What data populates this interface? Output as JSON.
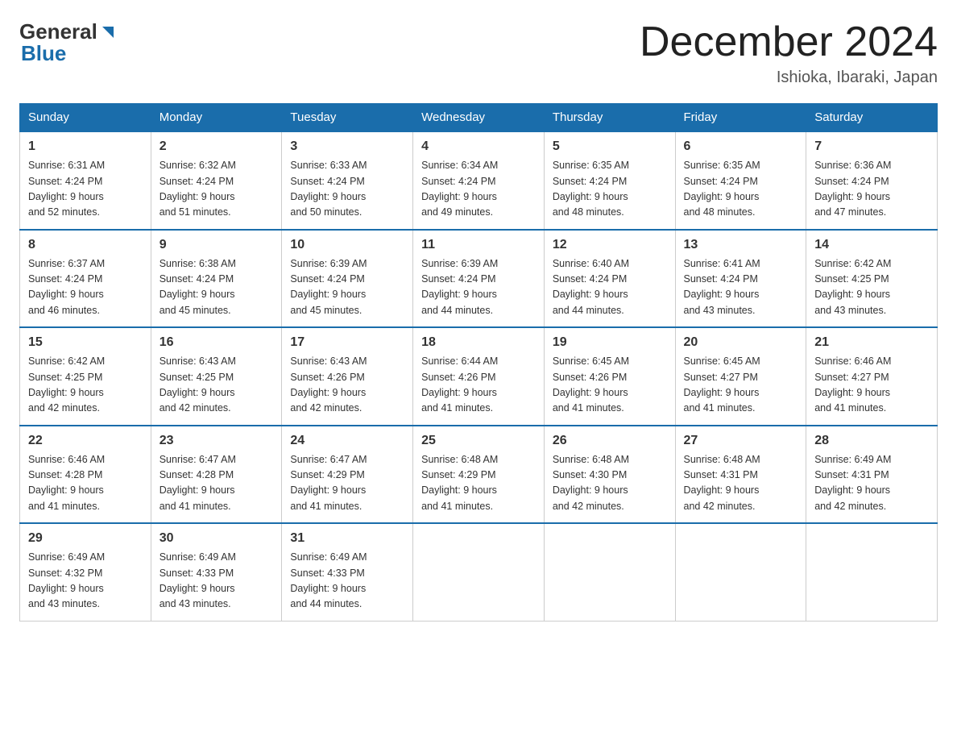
{
  "header": {
    "logo_general": "General",
    "logo_blue": "Blue",
    "title": "December 2024",
    "location": "Ishioka, Ibaraki, Japan"
  },
  "weekdays": [
    "Sunday",
    "Monday",
    "Tuesday",
    "Wednesday",
    "Thursday",
    "Friday",
    "Saturday"
  ],
  "weeks": [
    [
      {
        "day": "1",
        "sunrise": "6:31 AM",
        "sunset": "4:24 PM",
        "daylight": "9 hours and 52 minutes."
      },
      {
        "day": "2",
        "sunrise": "6:32 AM",
        "sunset": "4:24 PM",
        "daylight": "9 hours and 51 minutes."
      },
      {
        "day": "3",
        "sunrise": "6:33 AM",
        "sunset": "4:24 PM",
        "daylight": "9 hours and 50 minutes."
      },
      {
        "day": "4",
        "sunrise": "6:34 AM",
        "sunset": "4:24 PM",
        "daylight": "9 hours and 49 minutes."
      },
      {
        "day": "5",
        "sunrise": "6:35 AM",
        "sunset": "4:24 PM",
        "daylight": "9 hours and 48 minutes."
      },
      {
        "day": "6",
        "sunrise": "6:35 AM",
        "sunset": "4:24 PM",
        "daylight": "9 hours and 48 minutes."
      },
      {
        "day": "7",
        "sunrise": "6:36 AM",
        "sunset": "4:24 PM",
        "daylight": "9 hours and 47 minutes."
      }
    ],
    [
      {
        "day": "8",
        "sunrise": "6:37 AM",
        "sunset": "4:24 PM",
        "daylight": "9 hours and 46 minutes."
      },
      {
        "day": "9",
        "sunrise": "6:38 AM",
        "sunset": "4:24 PM",
        "daylight": "9 hours and 45 minutes."
      },
      {
        "day": "10",
        "sunrise": "6:39 AM",
        "sunset": "4:24 PM",
        "daylight": "9 hours and 45 minutes."
      },
      {
        "day": "11",
        "sunrise": "6:39 AM",
        "sunset": "4:24 PM",
        "daylight": "9 hours and 44 minutes."
      },
      {
        "day": "12",
        "sunrise": "6:40 AM",
        "sunset": "4:24 PM",
        "daylight": "9 hours and 44 minutes."
      },
      {
        "day": "13",
        "sunrise": "6:41 AM",
        "sunset": "4:24 PM",
        "daylight": "9 hours and 43 minutes."
      },
      {
        "day": "14",
        "sunrise": "6:42 AM",
        "sunset": "4:25 PM",
        "daylight": "9 hours and 43 minutes."
      }
    ],
    [
      {
        "day": "15",
        "sunrise": "6:42 AM",
        "sunset": "4:25 PM",
        "daylight": "9 hours and 42 minutes."
      },
      {
        "day": "16",
        "sunrise": "6:43 AM",
        "sunset": "4:25 PM",
        "daylight": "9 hours and 42 minutes."
      },
      {
        "day": "17",
        "sunrise": "6:43 AM",
        "sunset": "4:26 PM",
        "daylight": "9 hours and 42 minutes."
      },
      {
        "day": "18",
        "sunrise": "6:44 AM",
        "sunset": "4:26 PM",
        "daylight": "9 hours and 41 minutes."
      },
      {
        "day": "19",
        "sunrise": "6:45 AM",
        "sunset": "4:26 PM",
        "daylight": "9 hours and 41 minutes."
      },
      {
        "day": "20",
        "sunrise": "6:45 AM",
        "sunset": "4:27 PM",
        "daylight": "9 hours and 41 minutes."
      },
      {
        "day": "21",
        "sunrise": "6:46 AM",
        "sunset": "4:27 PM",
        "daylight": "9 hours and 41 minutes."
      }
    ],
    [
      {
        "day": "22",
        "sunrise": "6:46 AM",
        "sunset": "4:28 PM",
        "daylight": "9 hours and 41 minutes."
      },
      {
        "day": "23",
        "sunrise": "6:47 AM",
        "sunset": "4:28 PM",
        "daylight": "9 hours and 41 minutes."
      },
      {
        "day": "24",
        "sunrise": "6:47 AM",
        "sunset": "4:29 PM",
        "daylight": "9 hours and 41 minutes."
      },
      {
        "day": "25",
        "sunrise": "6:48 AM",
        "sunset": "4:29 PM",
        "daylight": "9 hours and 41 minutes."
      },
      {
        "day": "26",
        "sunrise": "6:48 AM",
        "sunset": "4:30 PM",
        "daylight": "9 hours and 42 minutes."
      },
      {
        "day": "27",
        "sunrise": "6:48 AM",
        "sunset": "4:31 PM",
        "daylight": "9 hours and 42 minutes."
      },
      {
        "day": "28",
        "sunrise": "6:49 AM",
        "sunset": "4:31 PM",
        "daylight": "9 hours and 42 minutes."
      }
    ],
    [
      {
        "day": "29",
        "sunrise": "6:49 AM",
        "sunset": "4:32 PM",
        "daylight": "9 hours and 43 minutes."
      },
      {
        "day": "30",
        "sunrise": "6:49 AM",
        "sunset": "4:33 PM",
        "daylight": "9 hours and 43 minutes."
      },
      {
        "day": "31",
        "sunrise": "6:49 AM",
        "sunset": "4:33 PM",
        "daylight": "9 hours and 44 minutes."
      },
      null,
      null,
      null,
      null
    ]
  ],
  "labels": {
    "sunrise": "Sunrise:",
    "sunset": "Sunset:",
    "daylight": "Daylight:"
  }
}
